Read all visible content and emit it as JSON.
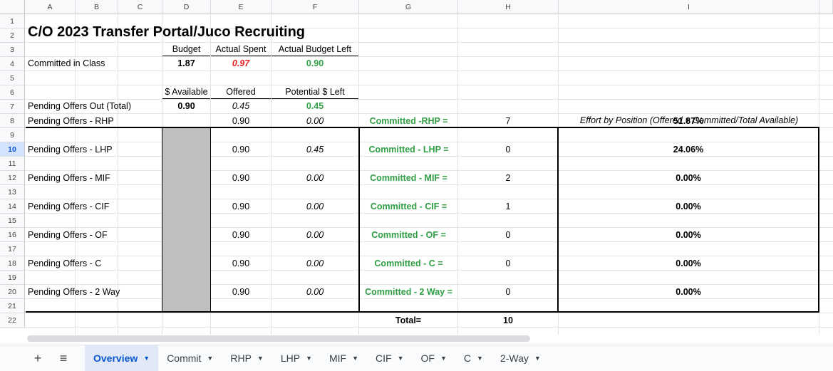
{
  "columns": [
    "A",
    "B",
    "C",
    "D",
    "E",
    "F",
    "G",
    "H",
    "I"
  ],
  "rows": [
    "1",
    "2",
    "3",
    "4",
    "5",
    "6",
    "7",
    "8",
    "9",
    "10",
    "11",
    "12",
    "13",
    "14",
    "15",
    "16",
    "17",
    "18",
    "19",
    "20",
    "21",
    "22"
  ],
  "title": "C/O 2023 Transfer Portal/Juco Recruiting",
  "budget_hdr": {
    "budget": "Budget",
    "spent": "Actual Spent",
    "left": "Actual Budget Left"
  },
  "committed": {
    "label": "Committed in Class",
    "budget": "1.87",
    "spent": "0.97",
    "left": "0.90"
  },
  "pending_hdr": {
    "available": "$ Available",
    "offered": "Offered",
    "potential": "Potential $ Left"
  },
  "pending_total": {
    "label": "Pending Offers Out (Total)",
    "available": "0.90",
    "offered": "0.45",
    "left": "0.45"
  },
  "effort_label": "Effort by Position (Offered + Committed/Total Available)",
  "positions": [
    {
      "label": "Pending Offers - RHP",
      "available": "0.90",
      "offered": "0.00",
      "committed_label": "Committed -RHP =",
      "count": "7",
      "effort": "51.87%"
    },
    {
      "label": "Pending Offers - LHP",
      "available": "0.90",
      "offered": "0.45",
      "committed_label": "Committed - LHP =",
      "count": "0",
      "effort": "24.06%"
    },
    {
      "label": "Pending Offers - MIF",
      "available": "0.90",
      "offered": "0.00",
      "committed_label": "Committed - MIF =",
      "count": "2",
      "effort": "0.00%"
    },
    {
      "label": "Pending Offers - CIF",
      "available": "0.90",
      "offered": "0.00",
      "committed_label": "Committed - CIF =",
      "count": "1",
      "effort": "0.00%"
    },
    {
      "label": "Pending Offers - OF",
      "available": "0.90",
      "offered": "0.00",
      "committed_label": "Committed - OF =",
      "count": "0",
      "effort": "0.00%"
    },
    {
      "label": "Pending Offers - C",
      "available": "0.90",
      "offered": "0.00",
      "committed_label": "Committed - C =",
      "count": "0",
      "effort": "0.00%"
    },
    {
      "label": "Pending Offers - 2 Way",
      "available": "0.90",
      "offered": "0.00",
      "committed_label": "Committed - 2 Way =",
      "count": "0",
      "effort": "0.00%"
    }
  ],
  "total": {
    "label": "Total=",
    "value": "10"
  },
  "tabs": [
    {
      "label": "Overview",
      "active": true
    },
    {
      "label": "Commit"
    },
    {
      "label": "RHP"
    },
    {
      "label": "LHP"
    },
    {
      "label": "MIF"
    },
    {
      "label": "CIF"
    },
    {
      "label": "OF"
    },
    {
      "label": "C"
    },
    {
      "label": "2-Way"
    }
  ],
  "icons": {
    "add": "plus-icon",
    "menu": "hamburger-icon",
    "dropdown": "caret-down-icon"
  },
  "colors": {
    "green": "#2f9e44",
    "red": "#e02020",
    "gray_fill": "#bfbfbf",
    "active_tab": "#0b57d0"
  }
}
